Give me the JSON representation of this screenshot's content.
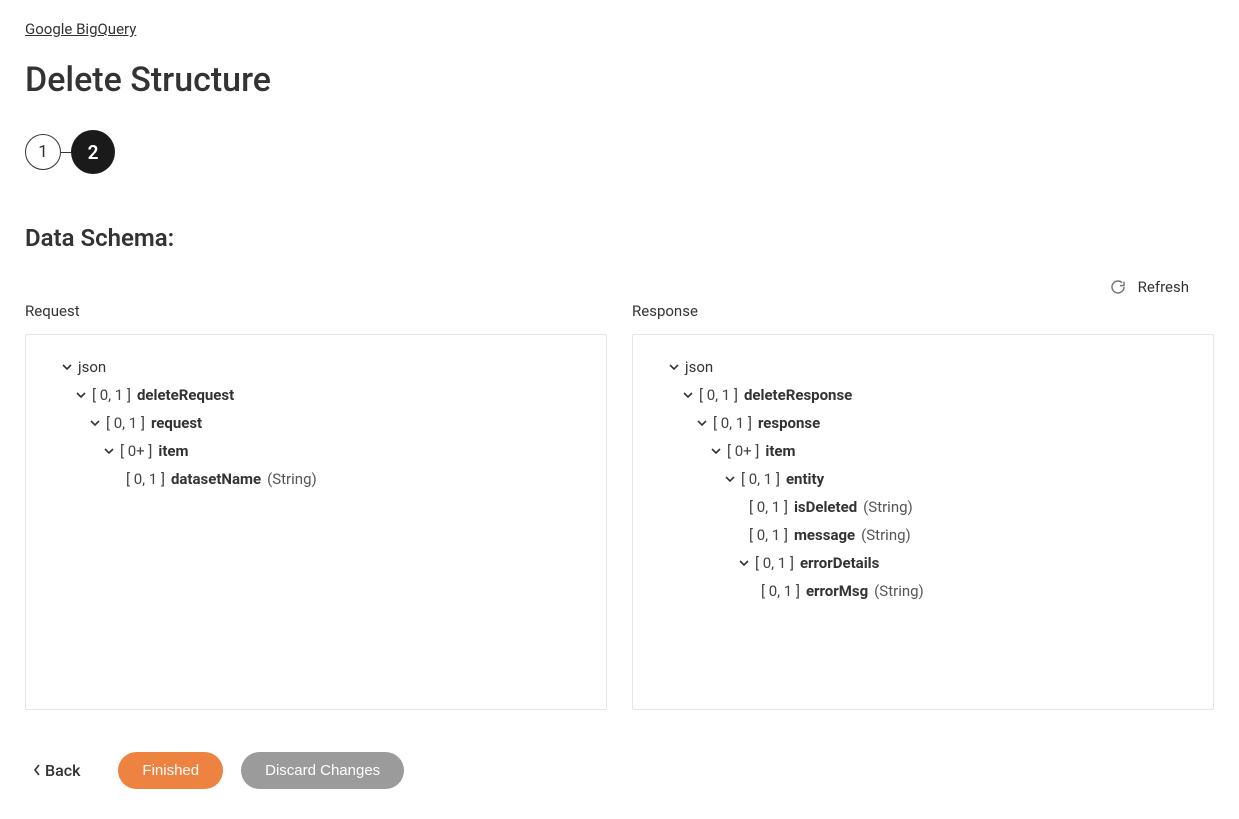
{
  "breadcrumb": {
    "label": "Google BigQuery"
  },
  "page": {
    "title": "Delete Structure"
  },
  "stepper": {
    "step1": "1",
    "step2": "2"
  },
  "section": {
    "title": "Data Schema:"
  },
  "refresh": {
    "label": "Refresh"
  },
  "request": {
    "header": "Request",
    "root": "json",
    "n1_card": "[ 0, 1 ]",
    "n1_name": "deleteRequest",
    "n2_card": "[ 0, 1 ]",
    "n2_name": "request",
    "n3_card": "[ 0+ ]",
    "n3_name": "item",
    "n4_card": "[ 0, 1 ]",
    "n4_name": "datasetName",
    "n4_type": "(String)"
  },
  "response": {
    "header": "Response",
    "root": "json",
    "n1_card": "[ 0, 1 ]",
    "n1_name": "deleteResponse",
    "n2_card": "[ 0, 1 ]",
    "n2_name": "response",
    "n3_card": "[ 0+ ]",
    "n3_name": "item",
    "n4_card": "[ 0, 1 ]",
    "n4_name": "entity",
    "n5_card": "[ 0, 1 ]",
    "n5_name": "isDeleted",
    "n5_type": "(String)",
    "n6_card": "[ 0, 1 ]",
    "n6_name": "message",
    "n6_type": "(String)",
    "n7_card": "[ 0, 1 ]",
    "n7_name": "errorDetails",
    "n8_card": "[ 0, 1 ]",
    "n8_name": "errorMsg",
    "n8_type": "(String)"
  },
  "footer": {
    "back": "Back",
    "finished": "Finished",
    "discard": "Discard Changes"
  }
}
